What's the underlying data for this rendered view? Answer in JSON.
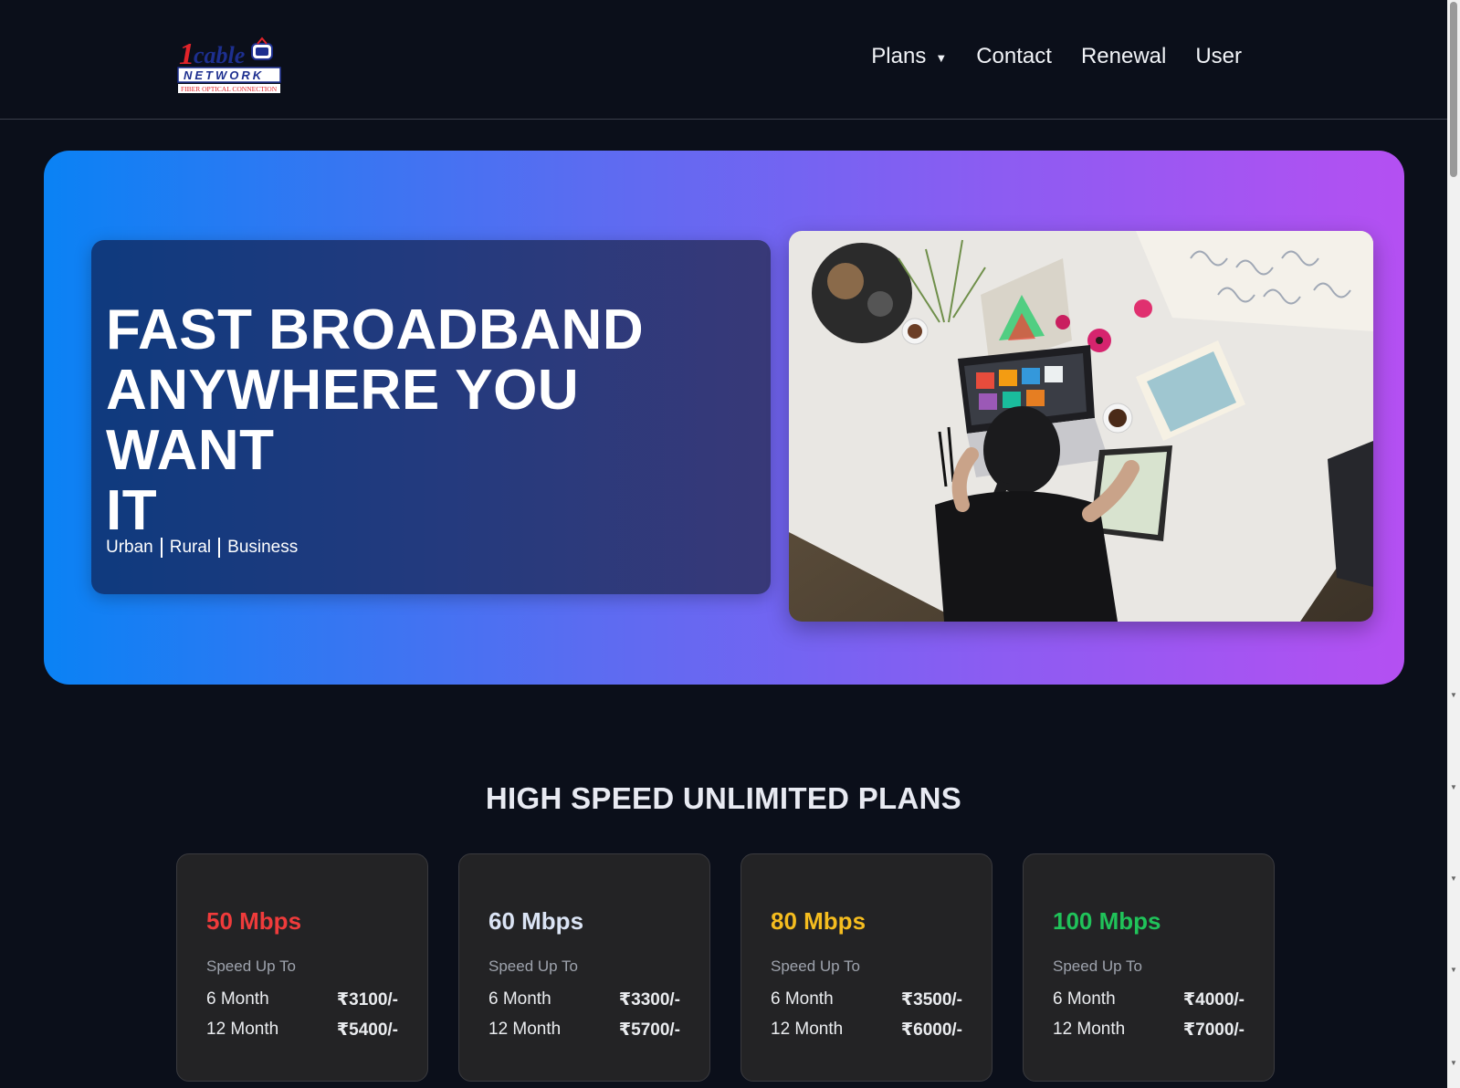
{
  "brand": {
    "logo_alt": "1cable NETWORK logo",
    "logo_text_top": "1cable",
    "logo_text_mid": "NETWORK",
    "logo_text_bottom": "FIBER OPTICAL CONNECTION"
  },
  "nav": {
    "items": [
      {
        "label": "Plans",
        "has_dropdown": true
      },
      {
        "label": "Contact"
      },
      {
        "label": "Renewal"
      },
      {
        "label": "User"
      }
    ]
  },
  "hero": {
    "title_lines": [
      "FAST BROADBAND",
      "ANYWHERE YOU WANT",
      "IT"
    ],
    "tags": [
      "Urban",
      "Rural",
      "Business"
    ],
    "image_alt": "Woman working at a laptop on a white table with flowers and art supplies"
  },
  "plans": {
    "heading": "HIGH SPEED UNLIMITED PLANS",
    "items": [
      {
        "speed": "50 Mbps",
        "color": "#ef3b3b",
        "sub": "Speed Up To",
        "rows": [
          {
            "term": "6 Month",
            "price": "₹3100/-"
          },
          {
            "term": "12 Month",
            "price": "₹5400/-"
          }
        ]
      },
      {
        "speed": "60 Mbps",
        "color": "#dbe4f5",
        "sub": "Speed Up To",
        "rows": [
          {
            "term": "6 Month",
            "price": "₹3300/-"
          },
          {
            "term": "12 Month",
            "price": "₹5700/-"
          }
        ]
      },
      {
        "speed": "80 Mbps",
        "color": "#f5bd1f",
        "sub": "Speed Up To",
        "rows": [
          {
            "term": "6 Month",
            "price": "₹3500/-"
          },
          {
            "term": "12 Month",
            "price": "₹6000/-"
          }
        ]
      },
      {
        "speed": "100 Mbps",
        "color": "#20c35a",
        "sub": "Speed Up To",
        "rows": [
          {
            "term": "6 Month",
            "price": "₹4000/-"
          },
          {
            "term": "12 Month",
            "price": "₹7000/-"
          }
        ]
      }
    ]
  },
  "colors": {
    "background": "#0b0f1a",
    "hero_gradient_start": "#0a82f4",
    "hero_gradient_end": "#b450f2",
    "card_bg": "#232325"
  }
}
